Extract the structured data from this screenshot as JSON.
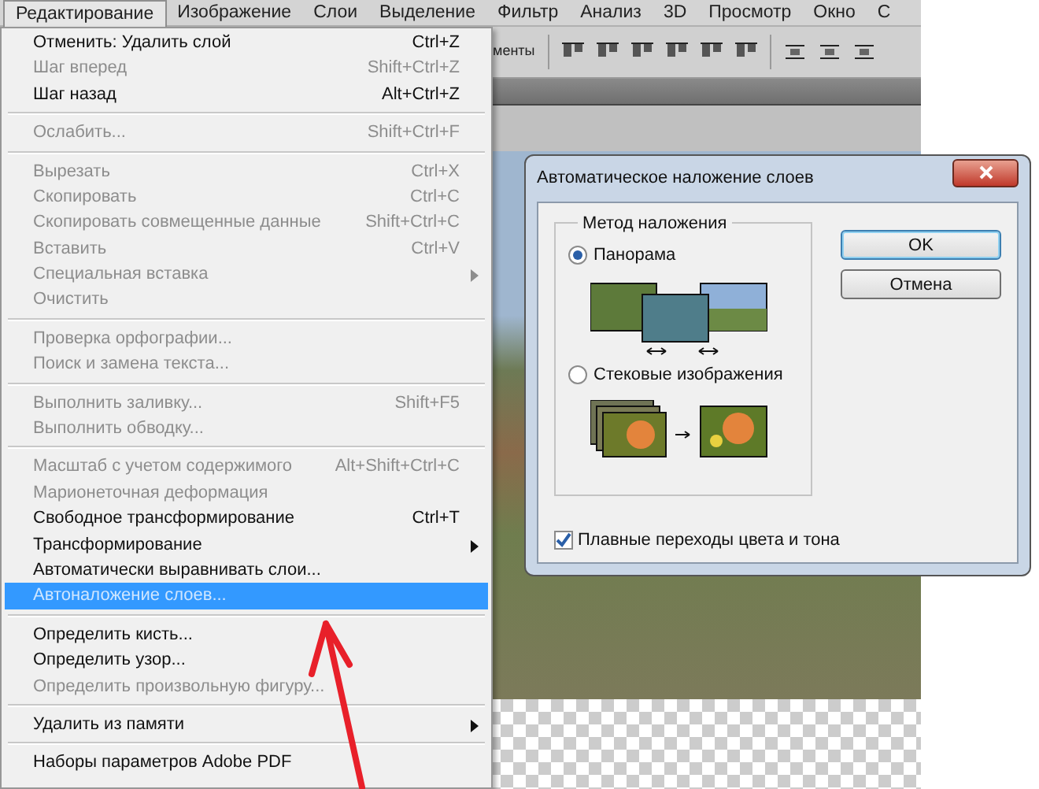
{
  "menu_bar": [
    {
      "label": "Редактирование",
      "selected": true
    },
    {
      "label": "Изображение",
      "selected": false
    },
    {
      "label": "Слои",
      "selected": false
    },
    {
      "label": "Выделение",
      "selected": false
    },
    {
      "label": "Фильтр",
      "selected": false
    },
    {
      "label": "Анализ",
      "selected": false
    },
    {
      "label": "3D",
      "selected": false
    },
    {
      "label": "Просмотр",
      "selected": false
    },
    {
      "label": "Окно",
      "selected": false
    },
    {
      "label": "С",
      "selected": false
    }
  ],
  "options_bar": {
    "label": "менты"
  },
  "edit_menu": [
    {
      "kind": "item",
      "label": "Отменить: Удалить слой",
      "shortcut": "Ctrl+Z",
      "disabled": false,
      "selected": false,
      "submenu": false
    },
    {
      "kind": "item",
      "label": "Шаг вперед",
      "shortcut": "Shift+Ctrl+Z",
      "disabled": true,
      "selected": false,
      "submenu": false
    },
    {
      "kind": "item",
      "label": "Шаг назад",
      "shortcut": "Alt+Ctrl+Z",
      "disabled": false,
      "selected": false,
      "submenu": false
    },
    {
      "kind": "separator"
    },
    {
      "kind": "item",
      "label": "Ослабить...",
      "shortcut": "Shift+Ctrl+F",
      "disabled": true,
      "selected": false,
      "submenu": false
    },
    {
      "kind": "separator"
    },
    {
      "kind": "item",
      "label": "Вырезать",
      "shortcut": "Ctrl+X",
      "disabled": true,
      "selected": false,
      "submenu": false
    },
    {
      "kind": "item",
      "label": "Скопировать",
      "shortcut": "Ctrl+C",
      "disabled": true,
      "selected": false,
      "submenu": false
    },
    {
      "kind": "item",
      "label": "Скопировать совмещенные данные",
      "shortcut": "Shift+Ctrl+C",
      "disabled": true,
      "selected": false,
      "submenu": false
    },
    {
      "kind": "item",
      "label": "Вставить",
      "shortcut": "Ctrl+V",
      "disabled": true,
      "selected": false,
      "submenu": false
    },
    {
      "kind": "item",
      "label": "Специальная вставка",
      "disabled": true,
      "selected": false,
      "submenu": true
    },
    {
      "kind": "item",
      "label": "Очистить",
      "disabled": true,
      "selected": false,
      "submenu": false
    },
    {
      "kind": "separator"
    },
    {
      "kind": "item",
      "label": "Проверка орфографии...",
      "disabled": true,
      "selected": false,
      "submenu": false
    },
    {
      "kind": "item",
      "label": "Поиск и замена текста...",
      "disabled": true,
      "selected": false,
      "submenu": false
    },
    {
      "kind": "separator"
    },
    {
      "kind": "item",
      "label": "Выполнить заливку...",
      "shortcut": "Shift+F5",
      "disabled": true,
      "selected": false,
      "submenu": false
    },
    {
      "kind": "item",
      "label": "Выполнить обводку...",
      "disabled": true,
      "selected": false,
      "submenu": false
    },
    {
      "kind": "separator"
    },
    {
      "kind": "item",
      "label": "Масштаб с учетом содержимого",
      "shortcut": "Alt+Shift+Ctrl+C",
      "disabled": true,
      "selected": false,
      "submenu": false
    },
    {
      "kind": "item",
      "label": "Марионеточная деформация",
      "disabled": true,
      "selected": false,
      "submenu": false
    },
    {
      "kind": "item",
      "label": "Свободное трансформирование",
      "shortcut": "Ctrl+T",
      "disabled": false,
      "selected": false,
      "submenu": false
    },
    {
      "kind": "item",
      "label": "Трансформирование",
      "disabled": false,
      "selected": false,
      "submenu": true
    },
    {
      "kind": "item",
      "label": "Автоматически выравнивать слои...",
      "disabled": false,
      "selected": false,
      "submenu": false
    },
    {
      "kind": "item",
      "label": "Автоналожение слоев...",
      "disabled": false,
      "selected": true,
      "submenu": false
    },
    {
      "kind": "separator"
    },
    {
      "kind": "item",
      "label": "Определить кисть...",
      "disabled": false,
      "selected": false,
      "submenu": false
    },
    {
      "kind": "item",
      "label": "Определить узор...",
      "disabled": false,
      "selected": false,
      "submenu": false
    },
    {
      "kind": "item",
      "label": "Определить произвольную фигуру...",
      "disabled": true,
      "selected": false,
      "submenu": false
    },
    {
      "kind": "separator"
    },
    {
      "kind": "item",
      "label": "Удалить из памяти",
      "disabled": false,
      "selected": false,
      "submenu": true
    },
    {
      "kind": "separator"
    },
    {
      "kind": "item",
      "label": "Наборы параметров Adobe PDF",
      "disabled": false,
      "selected": false,
      "submenu": false
    }
  ],
  "dialog": {
    "title": "Автоматическое наложение слоев",
    "group": {
      "title": "Метод наложения",
      "options": [
        {
          "label": "Панорама",
          "selected": true,
          "kind": "panorama"
        },
        {
          "label": "Стековые изображения",
          "selected": false,
          "kind": "stack"
        }
      ]
    },
    "checkbox": {
      "label": "Плавные переходы цвета и тона",
      "checked": true
    },
    "buttons": [
      {
        "label": "OK",
        "default": true
      },
      {
        "label": "Отмена",
        "default": false
      }
    ]
  }
}
